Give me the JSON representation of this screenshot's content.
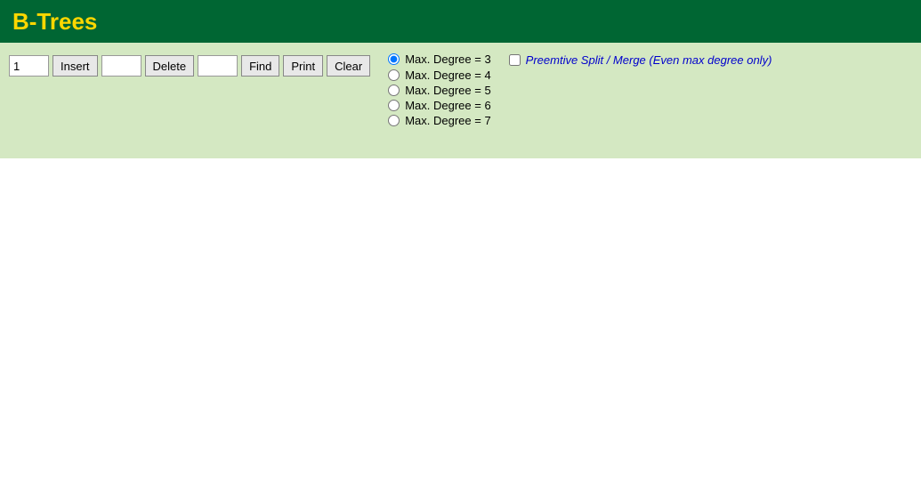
{
  "header": {
    "title": "B-Trees"
  },
  "toolbar": {
    "insert_value": "1",
    "insert_label": "Insert",
    "delete_input_value": "",
    "delete_label": "Delete",
    "find_input_value": "",
    "find_label": "Find",
    "print_label": "Print",
    "clear_label": "Clear"
  },
  "degree_options": [
    {
      "id": "deg3",
      "label": "Max. Degree = 3",
      "checked": true
    },
    {
      "id": "deg4",
      "label": "Max. Degree = 4",
      "checked": false
    },
    {
      "id": "deg5",
      "label": "Max. Degree = 5",
      "checked": false
    },
    {
      "id": "deg6",
      "label": "Max. Degree = 6",
      "checked": false
    },
    {
      "id": "deg7",
      "label": "Max. Degree = 7",
      "checked": false
    }
  ],
  "preemptive": {
    "label": "Preemtive Split / Merge (Even max degree only)"
  }
}
